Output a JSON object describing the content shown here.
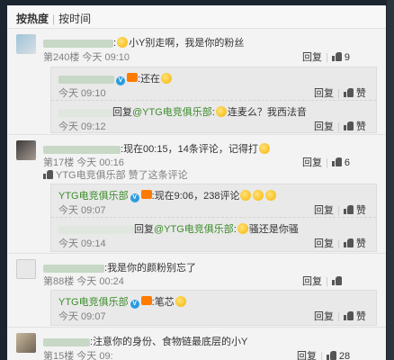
{
  "sortbar": {
    "hot": "按热度",
    "sep": "|",
    "time": "按时间"
  },
  "actions": {
    "reply": "回复",
    "like": "赞"
  },
  "comments": [
    {
      "text_prefix": ":",
      "text": "小Y别走啊，我是你的粉丝",
      "floor": "第240楼 今天 09:10",
      "likes": "9",
      "replies": [
        {
          "user_suffix": ":",
          "text": "还在",
          "time": "今天 09:10"
        },
        {
          "prefix": "回复",
          "mention": "@YTG电竞俱乐部",
          "sep": ":",
          "text": "连麦么？我西法音",
          "time": "今天 09:12"
        }
      ]
    },
    {
      "text_prefix": ":",
      "text": "现在00:15，14条评论，记得打",
      "floor": "第17楼 今天 00:16",
      "likes": "6",
      "liked_by": "YTG电竞俱乐部 赞了这条评论",
      "replies": [
        {
          "user": "YTG电竞俱乐部",
          "user_suffix": ":",
          "text": "现在9:06，238评论",
          "time": "今天 09:07"
        },
        {
          "prefix": "回复",
          "mention": "@YTG电竞俱乐部",
          "sep": ":",
          "text": "骚还是你骚",
          "time": "今天 09:14"
        }
      ]
    },
    {
      "text_prefix": ":",
      "text": "我是你的颜粉别忘了",
      "floor": "第88楼 今天 00:24",
      "likes": "",
      "replies": [
        {
          "user": "YTG电竞俱乐部",
          "user_suffix": ":",
          "text": "笔芯",
          "time": "今天 09:07"
        }
      ]
    },
    {
      "text_prefix": ":",
      "text": "注意你的身份、食物链最底层的小Y",
      "floor": "第15楼 今天 09:",
      "likes": "28"
    }
  ],
  "colors": {
    "username": "#eb7350",
    "link": "#3b8b2a",
    "meta": "#808080",
    "panel": "#f3f3f3"
  }
}
